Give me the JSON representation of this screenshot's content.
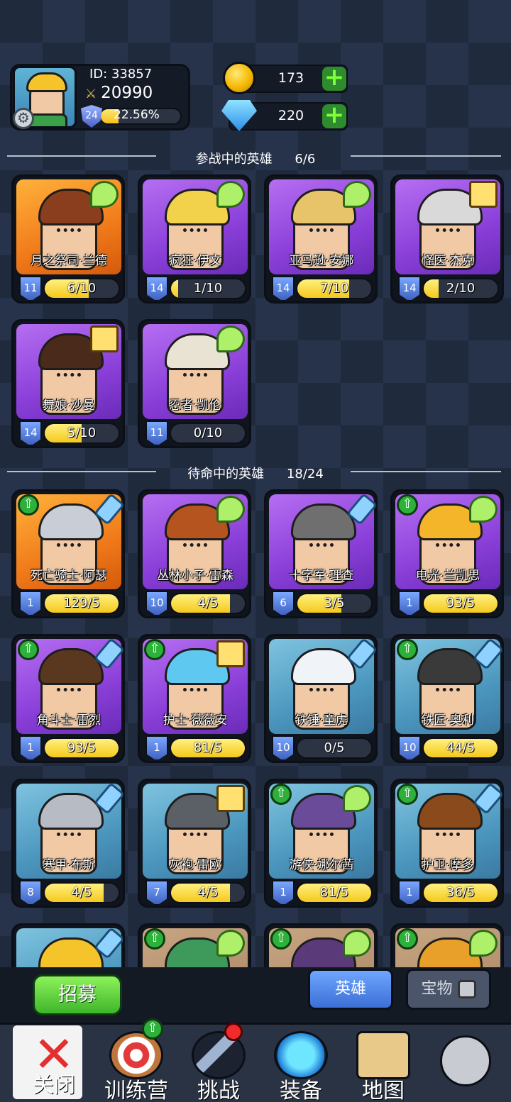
{
  "profile": {
    "id": "ID: 33857",
    "power": "20990",
    "level": "24",
    "xp_percent": "22.56%",
    "xp_fraction": 0.2256,
    "avatar_icon": "hero-avatar",
    "settings_icon": "gear-icon"
  },
  "currency": {
    "gold": "173",
    "gems": "220"
  },
  "sections": {
    "active": {
      "title": "参战中的英雄",
      "count": "6/6"
    },
    "standby": {
      "title": "待命中的英雄",
      "count": "18/24"
    }
  },
  "active_heroes": [
    {
      "name": "月之祭司·兰德",
      "level": "11",
      "progress": "6/10",
      "fill": 0.6,
      "bg": "orange",
      "hair": "#8a3e1e",
      "icon": "wing-icon"
    },
    {
      "name": "疯狂·伊文",
      "level": "14",
      "progress": "1/10",
      "fill": 0.1,
      "bg": "purple",
      "hair": "#f2d24a",
      "icon": "wing-icon"
    },
    {
      "name": "亚马逊·安娜",
      "level": "14",
      "progress": "7/10",
      "fill": 0.7,
      "bg": "purple",
      "hair": "#e7c36a",
      "icon": "wing-icon"
    },
    {
      "name": "怪医·杰克",
      "level": "14",
      "progress": "2/10",
      "fill": 0.2,
      "bg": "purple",
      "hair": "#d9d9d9",
      "icon": "book-icon"
    },
    {
      "name": "舞娘·沙曼",
      "level": "14",
      "progress": "5/10",
      "fill": 0.5,
      "bg": "purple",
      "hair": "#4a2a1a",
      "icon": "book-icon"
    },
    {
      "name": "忍者·凯伦",
      "level": "11",
      "progress": "0/10",
      "fill": 0,
      "bg": "purple",
      "hair": "#e8e3d2",
      "icon": "wing-icon"
    }
  ],
  "standby_heroes": [
    {
      "name": "死亡骑士·阿瑟",
      "level": "1",
      "progress": "129/5",
      "fill": 1,
      "bg": "orange",
      "hair": "#c9ced6",
      "icon": "sword-icon",
      "up": true
    },
    {
      "name": "丛林小子·雷森",
      "level": "10",
      "progress": "4/5",
      "fill": 0.8,
      "bg": "purple",
      "hair": "#b5541f",
      "icon": "wing-icon",
      "up": false
    },
    {
      "name": "十字军·理查",
      "level": "6",
      "progress": "3/5",
      "fill": 0.6,
      "bg": "purple",
      "hair": "#6f6f6f",
      "icon": "sword-icon",
      "up": false
    },
    {
      "name": "电光·兰凯思",
      "level": "1",
      "progress": "93/5",
      "fill": 1,
      "bg": "purple",
      "hair": "#f5b52a",
      "icon": "wing-icon",
      "up": true
    },
    {
      "name": "角斗士·雷烈",
      "level": "1",
      "progress": "93/5",
      "fill": 1,
      "bg": "purple",
      "hair": "#5a3820",
      "icon": "sword-icon",
      "up": true
    },
    {
      "name": "护士·薇薇安",
      "level": "1",
      "progress": "81/5",
      "fill": 1,
      "bg": "purple",
      "hair": "#5fc8f0",
      "icon": "book-icon",
      "up": true
    },
    {
      "name": "铁锤·童虎",
      "level": "10",
      "progress": "0/5",
      "fill": 0,
      "bg": "blue",
      "hair": "#f0f3f7",
      "icon": "sword-icon",
      "up": false
    },
    {
      "name": "铁匠·奥利",
      "level": "10",
      "progress": "44/5",
      "fill": 1,
      "bg": "blue",
      "hair": "#3a3a3a",
      "icon": "sword-icon",
      "up": true
    },
    {
      "name": "寒甲·布斯",
      "level": "8",
      "progress": "4/5",
      "fill": 0.8,
      "bg": "blue",
      "hair": "#b7bcc4",
      "icon": "sword-icon",
      "up": false
    },
    {
      "name": "灰袍·雷欧",
      "level": "7",
      "progress": "4/5",
      "fill": 0.8,
      "bg": "blue",
      "hair": "#5b5f66",
      "icon": "book-icon",
      "up": false
    },
    {
      "name": "游侠·娜尔茜",
      "level": "1",
      "progress": "81/5",
      "fill": 1,
      "bg": "blue",
      "hair": "#6a4b9a",
      "icon": "wing-icon",
      "up": true
    },
    {
      "name": "护卫·摩多",
      "level": "1",
      "progress": "36/5",
      "fill": 1,
      "bg": "blue",
      "hair": "#8a4a1c",
      "icon": "sword-icon",
      "up": true
    },
    {
      "name": "",
      "level": "",
      "progress": "",
      "fill": 0,
      "bg": "blue",
      "hair": "#f5c42a",
      "icon": "sword-icon",
      "up": false
    },
    {
      "name": "",
      "level": "",
      "progress": "",
      "fill": 0,
      "bg": "tan",
      "hair": "#3d9a5a",
      "icon": "wing-icon",
      "up": true
    },
    {
      "name": "",
      "level": "",
      "progress": "",
      "fill": 0,
      "bg": "tan",
      "hair": "#5b3a7a",
      "icon": "wing-icon",
      "up": true
    },
    {
      "name": "",
      "level": "",
      "progress": "",
      "fill": 0,
      "bg": "tan",
      "hair": "#e8a02a",
      "icon": "wing-icon",
      "up": true
    }
  ],
  "bottom": {
    "recruit": "招募",
    "tab_heroes": "英雄",
    "tab_locked": "宝物"
  },
  "nav": [
    {
      "label": "关闭",
      "icon": "close-icon"
    },
    {
      "label": "训练营",
      "icon": "training-target-icon"
    },
    {
      "label": "挑战",
      "icon": "sword-challenge-icon"
    },
    {
      "label": "装备",
      "icon": "armor-icon"
    },
    {
      "label": "地图",
      "icon": "map-icon"
    },
    {
      "label": "",
      "icon": "locked-icon"
    }
  ],
  "colors": {
    "accent_green": "#2db13a",
    "progress_yellow": "#f5c91c",
    "tab_active": "#3c6fd6",
    "alert_red": "#f02b2b"
  }
}
